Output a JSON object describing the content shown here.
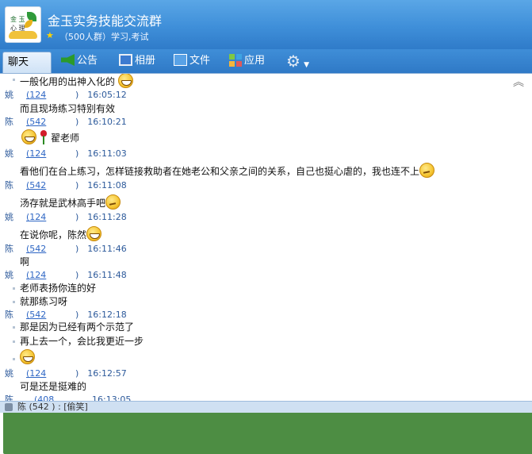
{
  "group": {
    "title": "金玉实务技能交流群",
    "subtitle": "（500人群）学习,考试",
    "avatar_line1": "金 玉",
    "avatar_line2": "心 理"
  },
  "toolbar": {
    "items": [
      {
        "label": "聊天",
        "icon": "chat-icon",
        "active": true
      },
      {
        "label": "公告",
        "icon": "megaphone-icon"
      },
      {
        "label": "相册",
        "icon": "album-icon"
      },
      {
        "label": "文件",
        "icon": "folder-icon"
      },
      {
        "label": "应用",
        "icon": "apps-icon"
      }
    ],
    "settings_icon": "gear-icon"
  },
  "chat": {
    "collapse_glyph": "︽",
    "top_message": "一般化用的出神入化的",
    "entries": [
      {
        "nick": "姚",
        "qq": "(124",
        "time": "16:05:12",
        "lines": [
          "而且现场练习特别有效"
        ]
      },
      {
        "nick": "陈",
        "qq": "(542",
        "time": "16:10:21",
        "lines": [
          "翟老师"
        ]
      },
      {
        "nick": "姚",
        "qq": "(124",
        "time": "16:11:03",
        "lines": [
          "看他们在台上练习，怎样链接救助者在她老公和父亲之间的关系，自己也挺心虐的，我也连不上"
        ]
      },
      {
        "nick": "陈",
        "qq": "(542",
        "time": "16:11:08",
        "lines": [
          "汤存就是武林高手吧"
        ]
      },
      {
        "nick": "姚",
        "qq": "(124",
        "time": "16:11:28",
        "lines": [
          "在说你呢，陈然"
        ]
      },
      {
        "nick": "陈",
        "qq": "(542",
        "time": "16:11:46",
        "lines": [
          "啊"
        ]
      },
      {
        "nick": "姚",
        "qq": "(124",
        "time": "16:11:48",
        "lines": [
          "老师表扬你连的好",
          "就那练习呀"
        ]
      },
      {
        "nick": "陈",
        "qq": "(542",
        "time": "16:12:18",
        "lines": [
          "那是因为已经有两个示范了",
          "再上去一个，会比我更近一步"
        ]
      },
      {
        "nick": "姚",
        "qq": "(124",
        "time": "16:12:57",
        "lines": [
          "可是还是挺难的"
        ]
      },
      {
        "nick": "陈",
        "qq": "(408",
        "time": "16:13:05",
        "lines": []
      }
    ],
    "qq_close": ")"
  },
  "bottom": {
    "text": "陈    (542        ) : [偷笑]"
  },
  "colors": {
    "header_blue": "#3f8fd9",
    "meta_blue": "#2d5a9b",
    "link_blue": "#2e66c4"
  }
}
